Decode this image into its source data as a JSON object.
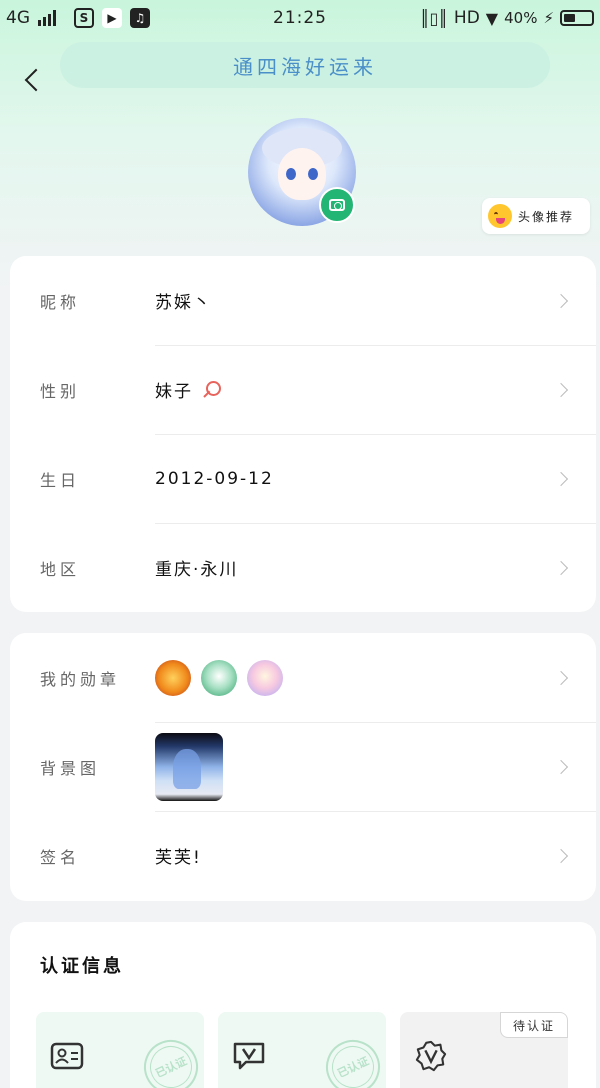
{
  "status_bar": {
    "network": "4G",
    "time": "21:25",
    "hd": "HD",
    "battery": "40%",
    "battery_level": 0.4
  },
  "header": {
    "back_icon": "chevron-left-icon",
    "title": "通四海好运来"
  },
  "avatar": {
    "camera_icon": "camera-icon",
    "recommend_label": "头像推荐",
    "recommend_icon": "tongue-emoji-icon"
  },
  "profile": {
    "nickname_label": "昵称",
    "nickname": "苏婇丶",
    "gender_label": "性别",
    "gender": "妹子",
    "gender_icon": "female-icon",
    "birthday_label": "生日",
    "birthday": "2012-09-12",
    "region_label": "地区",
    "region": "重庆·永川"
  },
  "extras": {
    "badges_label": "我的勋章",
    "badges": [
      "lion-badge-icon",
      "owl-badge-icon",
      "girl-badge-icon"
    ],
    "background_label": "背景图",
    "signature_label": "签名",
    "signature": "芙芙!"
  },
  "certification": {
    "title": "认证信息",
    "stamp_text": "已认证",
    "pending_label": "待认证",
    "items": [
      {
        "icon": "id-card-icon"
      },
      {
        "icon": "video-v-icon"
      },
      {
        "icon": "v-badge-icon"
      }
    ]
  },
  "colors": {
    "accent": "#22b573",
    "title_blue": "#4a8fc8",
    "female": "#e8635c"
  }
}
